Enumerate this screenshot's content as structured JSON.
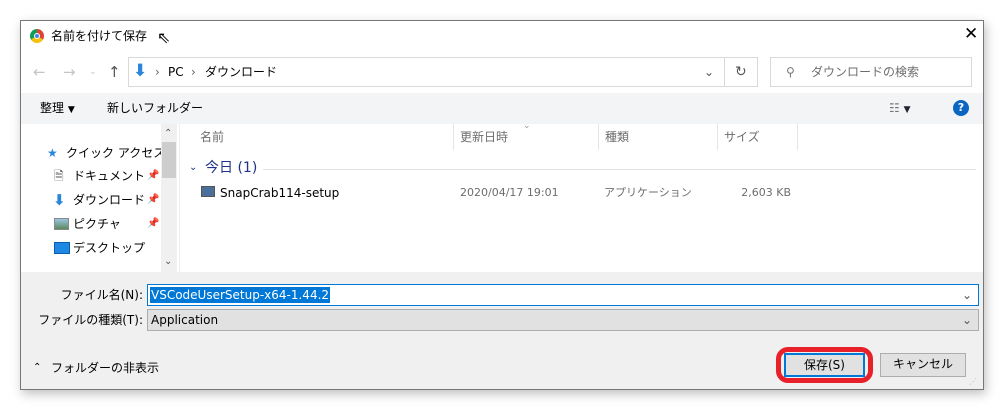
{
  "title": "名前を付けて保存",
  "breadcrumb": [
    "PC",
    "ダウンロード"
  ],
  "search_placeholder": "ダウンロードの検索",
  "toolbar": {
    "organize": "整理",
    "new_folder": "新しいフォルダー"
  },
  "nav": [
    {
      "label": "クイック アクセス",
      "icon": "star-icon"
    },
    {
      "label": "ドキュメント",
      "icon": "document-icon",
      "pinned": true
    },
    {
      "label": "ダウンロード",
      "icon": "download-icon",
      "pinned": true
    },
    {
      "label": "ピクチャ",
      "icon": "picture-icon",
      "pinned": true
    },
    {
      "label": "デスクトップ",
      "icon": "desktop-icon"
    }
  ],
  "columns": [
    "名前",
    "更新日時",
    "種類",
    "サイズ"
  ],
  "group": "今日 (1)",
  "files": [
    {
      "name": "SnapCrab114-setup",
      "date": "2020/04/17 19:01",
      "type": "アプリケーション",
      "size": "2,603 KB"
    }
  ],
  "filename_label": "ファイル名(N):",
  "filename_value": "VSCodeUserSetup-x64-1.44.2",
  "filetype_label": "ファイルの種類(T):",
  "filetype_value": "Application",
  "hide_folders": "フォルダーの非表示",
  "save": "保存(S)",
  "cancel": "キャンセル",
  "highlight_color": "#e8202a",
  "accent": "#0078d7"
}
